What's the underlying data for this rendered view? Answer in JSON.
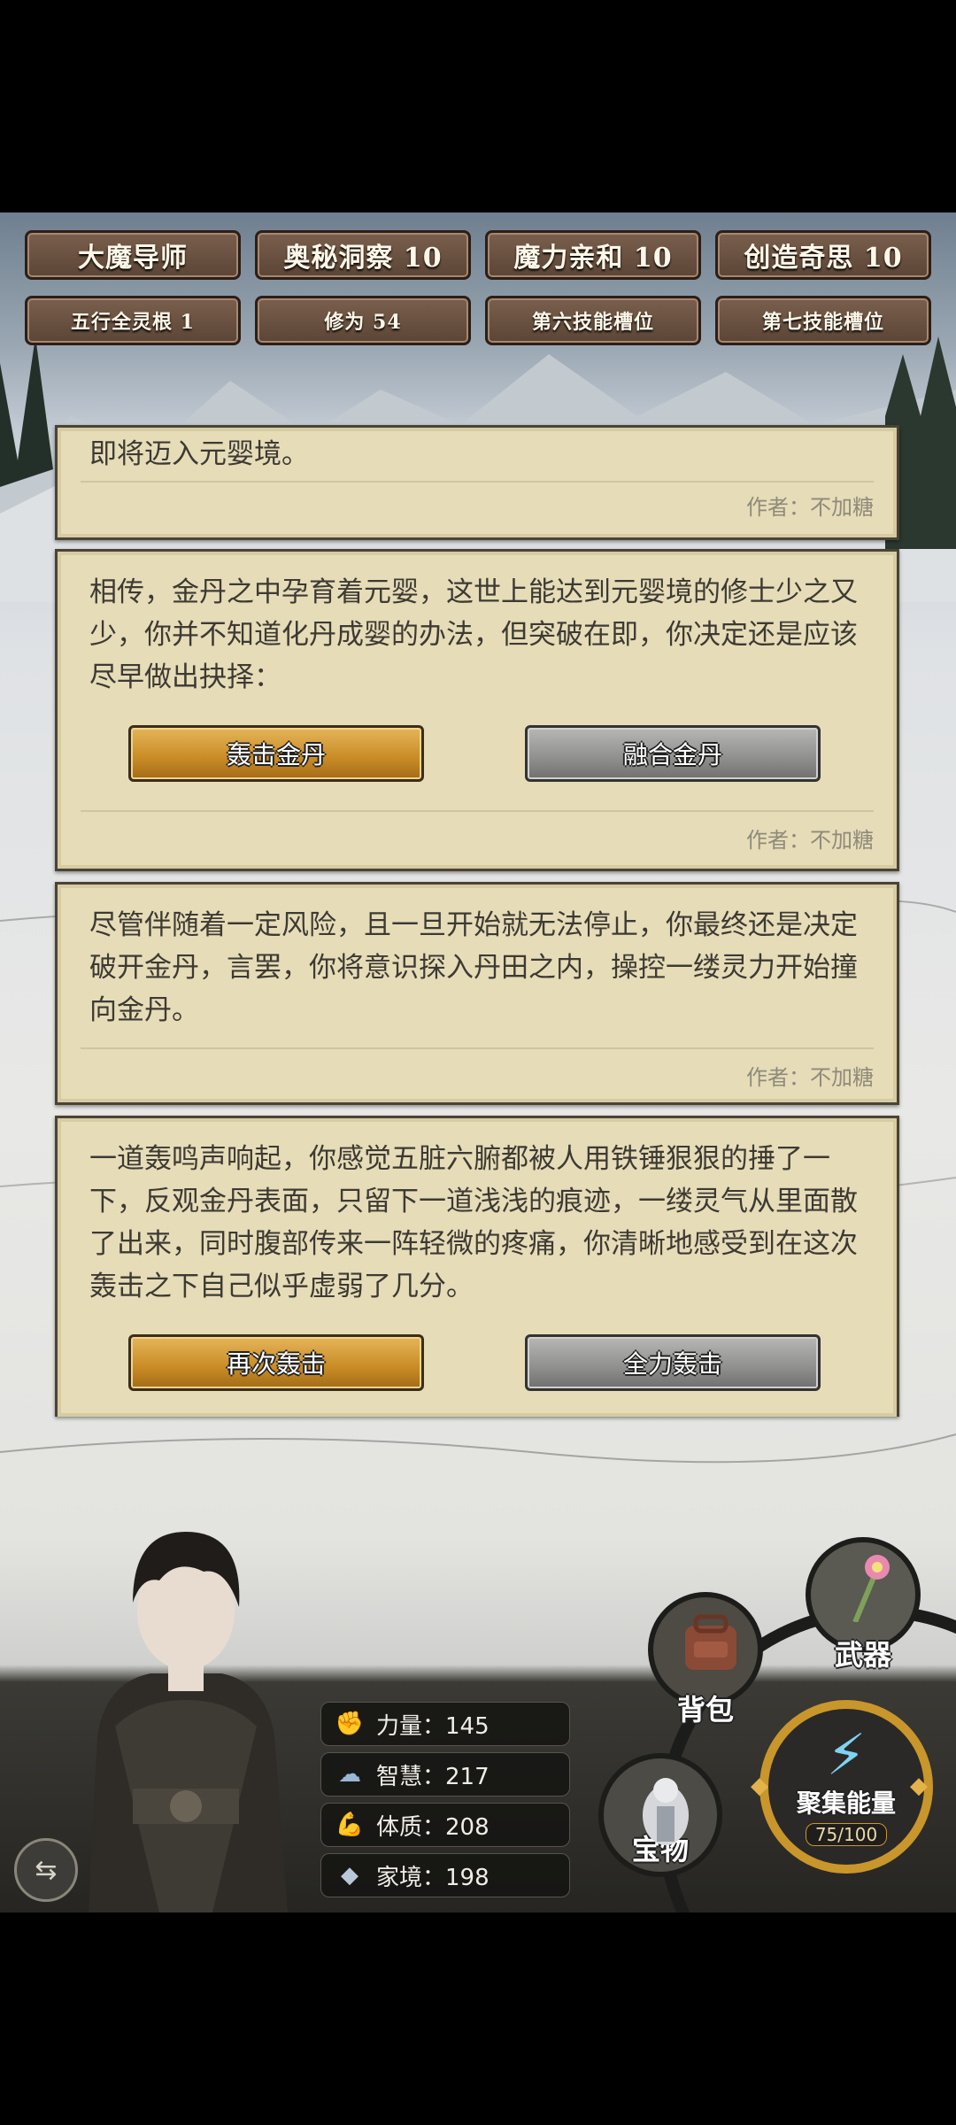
{
  "attributes_row1": [
    "大魔导师",
    "奥秘洞察 10",
    "魔力亲和 10",
    "创造奇思 10"
  ],
  "attributes_row2": [
    "五行全灵根 1",
    "修为 54",
    "第六技能槽位",
    "第七技能槽位"
  ],
  "story": [
    {
      "text": "即将迈入元婴境。",
      "author": "作者：不加糖"
    },
    {
      "text": "相传，金丹之中孕育着元婴，这世上能达到元婴境的修士少之又少，你并不知道化丹成婴的办法，但突破在即，你决定还是应该尽早做出抉择：",
      "choices": [
        "轰击金丹",
        "融合金丹"
      ],
      "author": "作者：不加糖"
    },
    {
      "text": "尽管伴随着一定风险，且一旦开始就无法停止，你最终还是决定破开金丹，言罢，你将意识探入丹田之内，操控一缕灵力开始撞向金丹。",
      "author": "作者：不加糖"
    },
    {
      "text": "一道轰鸣声响起，你感觉五脏六腑都被人用铁锤狠狠的捶了一下，反观金丹表面，只留下一道浅浅的痕迹，一缕灵气从里面散了出来，同时腹部传来一阵轻微的疼痛，你清晰地感受到在这次轰击之下自己似乎虚弱了几分。",
      "choices": [
        "再次轰击",
        "全力轰击"
      ]
    }
  ],
  "stats": [
    {
      "label": "力量：145",
      "icon": "fist-icon"
    },
    {
      "label": "智慧：217",
      "icon": "brain-icon"
    },
    {
      "label": "体质：208",
      "icon": "muscle-icon"
    },
    {
      "label": "家境：198",
      "icon": "diamond-icon"
    }
  ],
  "menu": {
    "weapon": "武器",
    "backpack": "背包",
    "treasure": "宝物",
    "energy_label": "聚集能量",
    "energy_value": "75/100"
  },
  "colors": {
    "gold_button": "#c88b25",
    "gray_button": "#8f8f8d",
    "card_bg": "#e6dcb8",
    "tag_bg": "#6a5140"
  }
}
